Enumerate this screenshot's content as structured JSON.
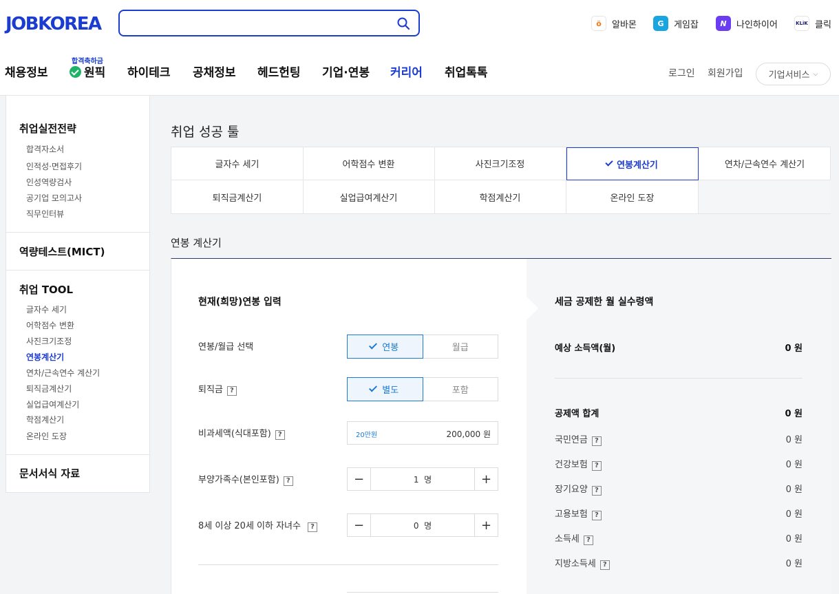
{
  "header": {
    "logo_text": "JOBKOREA",
    "search_placeholder": "",
    "family_sites": [
      {
        "label": "알바몬",
        "icon": "albamon-icon",
        "glyph": "ö",
        "color": "#f07a1a"
      },
      {
        "label": "게임잡",
        "icon": "gamejob-icon",
        "glyph": "G",
        "color": "#1aa4e0"
      },
      {
        "label": "나인하이어",
        "icon": "ninehire-icon",
        "glyph": "N",
        "color": "#6a3df0"
      },
      {
        "label": "클릭",
        "icon": "klik-icon",
        "glyph": "KLiK",
        "color": "#1a1a6e"
      }
    ],
    "nav": {
      "badge": "합격축하금",
      "items": [
        "채용정보",
        "원픽",
        "하이테크",
        "공채정보",
        "헤드헌팅",
        "기업·연봉",
        "커리어",
        "취업톡톡"
      ],
      "active_index": 6
    },
    "login": "로그인",
    "signup": "회원가입",
    "biz_service": "기업서비스"
  },
  "sidebar": {
    "sections": [
      {
        "title": "취업실전전략",
        "items": [
          "합격자소서",
          "인적성·면접후기",
          "인성역량검사",
          "공기업 모의고사",
          "직무인터뷰"
        ]
      },
      {
        "title": "역량테스트(MICT)",
        "items": []
      },
      {
        "title": "취업 TOOL",
        "items": [
          "글자수 세기",
          "어학점수 변환",
          "사진크기조정",
          "연봉계산기",
          "연차/근속연수 계산기",
          "퇴직금계산기",
          "실업급여계산기",
          "학점계산기",
          "온라인 도장"
        ]
      },
      {
        "title": "문서서식 자료",
        "items": []
      }
    ],
    "active_item": "연봉계산기"
  },
  "main": {
    "heading": "취업 성공 툴",
    "tabs": [
      "글자수 세기",
      "어학점수 변환",
      "사진크기조정",
      "연봉계산기",
      "연차/근속연수 계산기",
      "퇴직금계산기",
      "실업급여계산기",
      "학점계산기",
      "온라인 도장"
    ],
    "active_tab": 3,
    "section_title": "연봉 계산기"
  },
  "calculator": {
    "input_title": "현재(희망)연봉 입력",
    "pay_type": {
      "label": "연봉/월급 선택",
      "options": [
        "연봉",
        "월급"
      ],
      "selected": 0
    },
    "severance": {
      "label": "퇴직금",
      "help": "?",
      "options": [
        "별도",
        "포함"
      ],
      "selected": 0
    },
    "nontax": {
      "label": "비과세액(식대포함)",
      "help": "?",
      "hint": "20만원",
      "value": "200,000",
      "unit": "원"
    },
    "dependents": {
      "label": "부양가족수(본인포함)",
      "help": "?",
      "value": "1",
      "unit": "명",
      "minus": "−",
      "plus": "+"
    },
    "children": {
      "label": "8세 이상 20세 이하 자녀수",
      "help": "?",
      "value": "0",
      "unit": "명",
      "minus": "−",
      "plus": "+"
    }
  },
  "result": {
    "title": "세금 공제한 월 실수령액",
    "expected": {
      "label": "예상 소득액(월)",
      "value": "0 원"
    },
    "total_deduction": {
      "label": "공제액 합계",
      "value": "0 원"
    },
    "deductions": [
      {
        "label": "국민연금",
        "help": "?",
        "value": "0 원"
      },
      {
        "label": "건강보험",
        "help": "?",
        "value": "0 원"
      },
      {
        "label": "장기요양",
        "help": "?",
        "value": "0 원"
      },
      {
        "label": "고용보험",
        "help": "?",
        "value": "0 원"
      },
      {
        "label": "소득세",
        "help": "?",
        "value": "0 원"
      },
      {
        "label": "지방소득세",
        "help": "?",
        "value": "0 원"
      }
    ]
  },
  "colors": {
    "brand": "#1a3cd0",
    "accent": "#1a7bd6",
    "logo_highlight": "#b7f23c",
    "onepick_check": "#1fb36a"
  }
}
